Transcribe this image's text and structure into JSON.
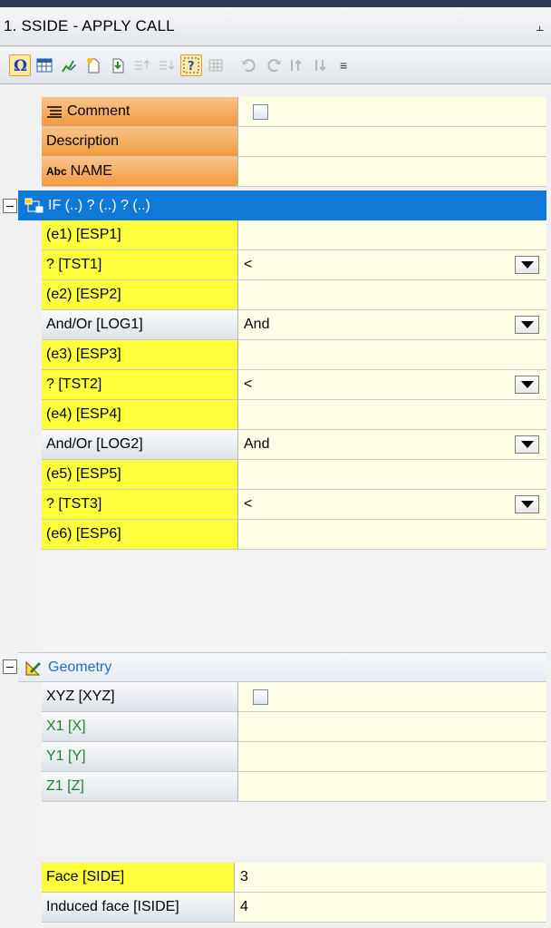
{
  "panel": {
    "title": "1. SSIDE - APPLY CALL",
    "pin_icon": "pin-icon"
  },
  "toolbar": {
    "buttons": [
      {
        "name": "omega-icon",
        "enabled": true,
        "selected": true
      },
      {
        "name": "table-icon",
        "enabled": true
      },
      {
        "name": "edit-chart-icon",
        "enabled": true
      },
      {
        "name": "new-page-icon",
        "enabled": true
      },
      {
        "name": "import-page-icon",
        "enabled": true
      },
      {
        "name": "insert-before-icon",
        "enabled": false
      },
      {
        "name": "insert-after-icon",
        "enabled": false
      },
      {
        "name": "help-select-icon",
        "enabled": true,
        "selected": true
      },
      {
        "name": "grid-disabled-icon",
        "enabled": false
      },
      {
        "name": "undo-icon",
        "enabled": false
      },
      {
        "name": "redo-icon",
        "enabled": false
      },
      {
        "name": "move-up-icon",
        "enabled": false
      },
      {
        "name": "move-down-icon",
        "enabled": false
      }
    ],
    "overflow_icon": "chevron-more-icon"
  },
  "rows": [
    {
      "label": "Comment",
      "icon": "comment-lines-icon",
      "style": "orange",
      "value_type": "checkbox",
      "checked": false
    },
    {
      "label": "Description",
      "style": "orange",
      "value_type": "text",
      "value": ""
    },
    {
      "label": "NAME",
      "icon_text": "Abc",
      "style": "orange",
      "value_type": "text",
      "value": ""
    }
  ],
  "if_group": {
    "label": "IF (..) ? (..) ? (..)",
    "icon": "flowchart-icon",
    "rows": [
      {
        "label": "(e1) [ESP1]",
        "style": "yellow",
        "value": ""
      },
      {
        "label": "? [TST1]",
        "style": "yellow",
        "value": "<",
        "dropdown": true
      },
      {
        "label": "(e2) [ESP2]",
        "style": "yellow",
        "value": ""
      },
      {
        "label": "And/Or [LOG1]",
        "style": "gray",
        "value": "And",
        "dropdown": true
      },
      {
        "label": "(e3) [ESP3]",
        "style": "yellow",
        "value": ""
      },
      {
        "label": "? [TST2]",
        "style": "yellow",
        "value": "<",
        "dropdown": true
      },
      {
        "label": "(e4) [ESP4]",
        "style": "yellow",
        "value": ""
      },
      {
        "label": "And/Or [LOG2]",
        "style": "gray",
        "value": "And",
        "dropdown": true
      },
      {
        "label": "(e5) [ESP5]",
        "style": "yellow",
        "value": ""
      },
      {
        "label": "? [TST3]",
        "style": "yellow",
        "value": "<",
        "dropdown": true
      },
      {
        "label": "(e6) [ESP6]",
        "style": "yellow",
        "value": ""
      }
    ]
  },
  "geometry_group": {
    "label": "Geometry",
    "icon": "geometry-ruler-icon",
    "rows": [
      {
        "label": "XYZ [XYZ]",
        "style": "gray",
        "value_type": "checkbox",
        "checked": false
      },
      {
        "label": "X1 [X]",
        "style": "gray-green",
        "value": ""
      },
      {
        "label": "Y1 [Y]",
        "style": "gray-green",
        "value": ""
      },
      {
        "label": "Z1 [Z]",
        "style": "gray-green",
        "value": ""
      }
    ]
  },
  "bottom_rows": [
    {
      "label": "Face [SIDE]",
      "style": "yellow",
      "value": "3"
    },
    {
      "label": "Induced face [ISIDE]",
      "style": "gray",
      "value": "4"
    }
  ],
  "colors": {
    "title_strip": "#2c3b53",
    "group_highlight": "#0f79d8",
    "value_bg": "#ffffe7",
    "yellow_label": "#ffff3c",
    "orange_label": "#f39a3e",
    "green_text": "#23812a"
  }
}
